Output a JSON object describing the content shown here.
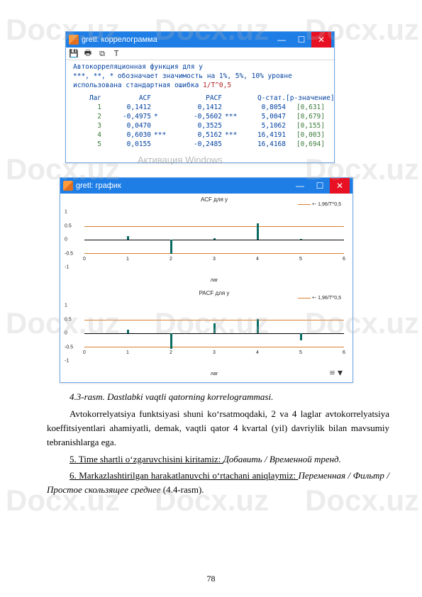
{
  "watermark_text": "Docx.uz",
  "correlogram_window": {
    "title": "gretl: коррелограмма",
    "header_line1": "Автокорреляционная функция для y",
    "header_line2_pre": "***, **, * обозначает значимость на 1%, 5%, 10% уровне",
    "header_line3_pre": "использована стандартная ошибка ",
    "header_t": "1/T^0,5",
    "columns": {
      "lag": "Лаг",
      "acf": "ACF",
      "pacf": "PACF",
      "q": "Q-стат.",
      "p": "[p-значение]"
    },
    "rows": [
      {
        "lag": "1",
        "acf": "0,1412",
        "mark": "",
        "pacf": "0,1412",
        "mark2": "",
        "q": "0,8054",
        "p": "[0,631]"
      },
      {
        "lag": "2",
        "acf": "-0,4975",
        "mark": "*",
        "pacf": "-0,5602",
        "mark2": "***",
        "q": "5,0047",
        "p": "[0,679]"
      },
      {
        "lag": "3",
        "acf": "0,0470",
        "mark": "",
        "pacf": "0,3525",
        "mark2": "",
        "q": "5,1062",
        "p": "[0,155]"
      },
      {
        "lag": "4",
        "acf": "0,6030",
        "mark": "***",
        "pacf": "0,5162",
        "mark2": "***",
        "q": "16,4191",
        "p": "[0,003]"
      },
      {
        "lag": "5",
        "acf": "0,0155",
        "mark": "",
        "pacf": "-0,2485",
        "mark2": "",
        "q": "16,4168",
        "p": "[0,694]"
      }
    ]
  },
  "activation_text": "Активация Windows",
  "graph_window": {
    "title": "gretl: график",
    "acf": {
      "title": "ACF для y",
      "legend": "+- 1,96/T^0,5",
      "xlabel": "лаг"
    },
    "pacf": {
      "title": "PACF для y",
      "legend": "+- 1,96/T^0,5",
      "xlabel": "лаг"
    },
    "yticks": [
      "1",
      "0.5",
      "0",
      "-0.5",
      "-1"
    ],
    "xticks": [
      "0",
      "1",
      "2",
      "3",
      "4",
      "5",
      "6"
    ]
  },
  "chart_data": [
    {
      "type": "bar",
      "title": "ACF для y",
      "xlabel": "лаг",
      "categories": [
        1,
        2,
        3,
        4,
        5
      ],
      "values": [
        0.14,
        -0.5,
        0.05,
        0.6,
        0.02
      ],
      "ylim": [
        -1,
        1
      ],
      "ci": 0.49,
      "legend": "+- 1,96/T^0,5"
    },
    {
      "type": "bar",
      "title": "PACF для y",
      "xlabel": "лаг",
      "categories": [
        1,
        2,
        3,
        4,
        5
      ],
      "values": [
        0.14,
        -0.56,
        0.35,
        0.52,
        -0.25
      ],
      "ylim": [
        -1,
        1
      ],
      "ci": 0.49,
      "legend": "+- 1,96/T^0,5"
    }
  ],
  "doc": {
    "caption": "4.3-rasm. Dastlabki vaqtli qatorning korrelogrammasi.",
    "p1": "Avtokorrelyatsiya funktsiyasi shuni ko‘rsatmoqdaki, 2 va 4 laglar avtokorrelyatsiya koeffitsiyentlari ahamiyatli, demak, vaqtli qator 4 kvartal (yil) davriylik bilan mavsumiy tebranishlarga ega.",
    "p2_pre": "5. Time shartli o‘zgaruvchisini kiritamiz: ",
    "p2_it": "Добавить / Временной тренд.",
    "p3_pre": "6. Markazlashtirilgan harakatlanuvchi o‘rtachani aniqlaymiz: ",
    "p3_it": "Переменная / Фильтр / Простое скользящее среднее ",
    "p3_post": "(4.4-rasm).",
    "page": "78"
  }
}
